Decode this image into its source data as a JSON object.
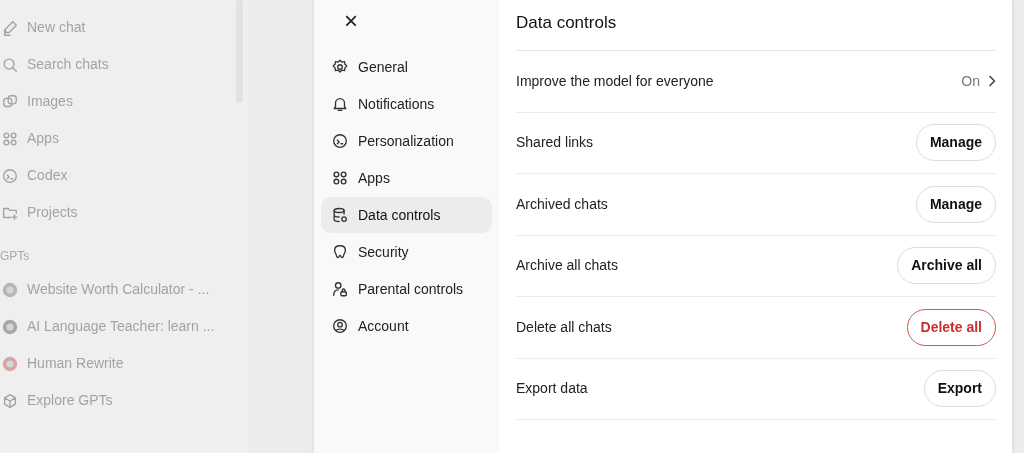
{
  "sidebar": {
    "items": [
      {
        "label": "New chat"
      },
      {
        "label": "Search chats"
      },
      {
        "label": "Images"
      },
      {
        "label": "Apps"
      },
      {
        "label": "Codex"
      },
      {
        "label": "Projects"
      }
    ],
    "section_title": "GPTs",
    "gpts": [
      {
        "label": "Website Worth Calculator - ...",
        "kind": "gpt"
      },
      {
        "label": "AI Language Teacher: learn ...",
        "kind": "gpt"
      },
      {
        "label": "Human Rewrite",
        "kind": "gpt"
      },
      {
        "label": "Explore GPTs",
        "kind": "explore"
      }
    ]
  },
  "settings": {
    "close": "×",
    "nav": [
      {
        "label": "General",
        "selected": false
      },
      {
        "label": "Notifications",
        "selected": false
      },
      {
        "label": "Personalization",
        "selected": false
      },
      {
        "label": "Apps",
        "selected": false
      },
      {
        "label": "Data controls",
        "selected": true
      },
      {
        "label": "Security",
        "selected": false
      },
      {
        "label": "Parental controls",
        "selected": false
      },
      {
        "label": "Account",
        "selected": false
      }
    ],
    "title": "Data controls",
    "rows": [
      {
        "kind": "value",
        "label": "Improve the model for everyone",
        "value": "On"
      },
      {
        "kind": "button",
        "label": "Shared links",
        "button": "Manage",
        "destructive": false
      },
      {
        "kind": "button",
        "label": "Archived chats",
        "button": "Manage",
        "destructive": false
      },
      {
        "kind": "button",
        "label": "Archive all chats",
        "button": "Archive all",
        "destructive": false
      },
      {
        "kind": "button",
        "label": "Delete all chats",
        "button": "Delete all",
        "destructive": true
      },
      {
        "kind": "button",
        "label": "Export data",
        "button": "Export",
        "destructive": false
      }
    ]
  }
}
